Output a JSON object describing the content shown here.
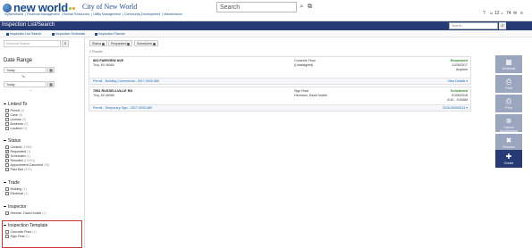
{
  "header": {
    "logo": "new world",
    "city_title": "City of New World",
    "nav": [
      "myNewWorld",
      "Financial Management",
      "Human Resources",
      "Utility Management",
      "Community Development",
      "Maintenance"
    ],
    "search_placeholder": "Search",
    "right_badges": [
      "0",
      "12",
      "74"
    ]
  },
  "titlebar": {
    "title": "Inspection List/Search",
    "search_placeholder": "Search..."
  },
  "subbar": {
    "links": [
      "Inspection List Search",
      "Inspection Scheduler",
      "Inspection Planner"
    ]
  },
  "sidebar": {
    "keyword_placeholder": "Keyword Search",
    "date_range": {
      "title": "Date Range",
      "from": "Today",
      "to_label": "To",
      "to": "Today"
    },
    "sections": [
      {
        "title": "Linked To",
        "items": [
          {
            "label": "Permit",
            "count": "(2)",
            "checked": false
          },
          {
            "label": "Case",
            "count": "(0)",
            "checked": false
          },
          {
            "label": "License",
            "count": "(0)",
            "checked": false
          },
          {
            "label": "Business",
            "count": "(0)",
            "checked": false
          },
          {
            "label": "Location",
            "count": "(0)",
            "checked": false
          }
        ]
      },
      {
        "title": "Status",
        "items": [
          {
            "label": "Created",
            "count": "(1988)",
            "checked": false
          },
          {
            "label": "Requested",
            "count": "(1)",
            "checked": true
          },
          {
            "label": "Scheduled",
            "count": "(1)",
            "checked": true
          },
          {
            "label": "Resulted",
            "count": "(10004)",
            "checked": false
          },
          {
            "label": "Appointment Canceled",
            "count": "(28)",
            "checked": false
          },
          {
            "label": "Past Due",
            "count": "(878)",
            "checked": false
          }
        ]
      },
      {
        "title": "Trade",
        "items": [
          {
            "label": "Building",
            "count": "(1)",
            "checked": false
          },
          {
            "label": "Electrical",
            "count": "(1)",
            "checked": false
          }
        ]
      },
      {
        "title": "Inspector",
        "items": [
          {
            "label": "Herman, David Inoble",
            "count": "(1)",
            "checked": false
          }
        ]
      },
      {
        "title": "Inspection Template",
        "items": [
          {
            "label": "Concrete Floor",
            "count": "(1)",
            "checked": false
          },
          {
            "label": "Sign Final",
            "count": "(1)",
            "checked": false
          }
        ]
      }
    ]
  },
  "filters": {
    "chips": [
      "Status",
      "Requested",
      "Scheduled"
    ]
  },
  "results": {
    "count_label": "2 Results",
    "cards": [
      {
        "address": "863 FAIRVIEW AVE",
        "city": "Troy, MI 48084",
        "type": "Concrete Floor",
        "inspector": "(Unassigned)",
        "status": "Requested",
        "date": "11/28/2017",
        "time": "Anytime",
        "permit": "Permit - Building Commercial - 2017-0000-560",
        "details": "View Details ▾"
      },
      {
        "address": "7981 RUSSELLVILLE RD",
        "city": "Troy, MI 48085",
        "type": "Sign Final",
        "inspector": "Hermann, David Inoble",
        "status": "Scheduled",
        "date": "01/06/2018",
        "time": "8:30 - 9:00AM",
        "permit": "Permit - Temporary Sign - 2017-0000-569",
        "details": "2018-00000013 ▾"
      }
    ]
  },
  "actions": [
    {
      "label": "Schedule",
      "icon": "calendar-icon",
      "glyph": "▦"
    },
    {
      "label": "Print",
      "icon": "print-icon",
      "glyph": "⎙"
    },
    {
      "label": "Print",
      "icon": "print-icon",
      "glyph": "⎙"
    },
    {
      "label": "Cancel Appointment",
      "icon": "cancel-appointment-icon",
      "glyph": "⊗"
    },
    {
      "label": "Remove",
      "icon": "remove-icon",
      "glyph": "✖"
    },
    {
      "label": "Create",
      "icon": "plus-icon",
      "glyph": "✚"
    }
  ],
  "colors": {
    "brand": "#1e4e8c",
    "titlebar": "#283a74",
    "action": "#9aa5be",
    "status_green": "#2e8b2e",
    "highlight": "#c0392b"
  }
}
